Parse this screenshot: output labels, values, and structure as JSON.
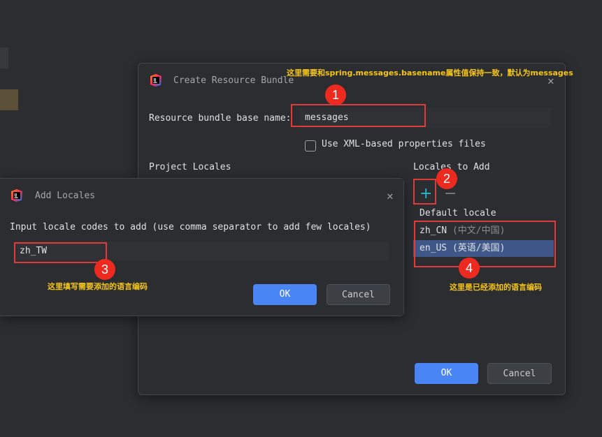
{
  "main_dialog": {
    "title": "Create Resource Bundle",
    "base_name_label": "Resource bundle base name:",
    "base_name_value": "messages",
    "xml_checkbox_label": "Use XML-based properties files",
    "project_locales_label": "Project Locales",
    "locales_to_add_label": "Locales to Add",
    "locales": [
      {
        "code": "Default locale",
        "hint": ""
      },
      {
        "code": "zh_CN",
        "hint": "(中文/中国)"
      },
      {
        "code": "en_US",
        "hint": "(英语/美国)"
      }
    ],
    "ok_label": "OK",
    "cancel_label": "Cancel",
    "add_symbol": "+",
    "remove_symbol": "−"
  },
  "add_dialog": {
    "title": "Add Locales",
    "prompt": "Input locale codes to add (use comma separator to add few locales)",
    "input_value": "zh_TW",
    "ok_label": "OK",
    "cancel_label": "Cancel"
  },
  "annotations": {
    "badge1": "1",
    "badge2": "2",
    "badge3": "3",
    "badge4": "4",
    "note_top": "这里需要和spring.messages.basename属性值保持一致，默认为messages",
    "note_input": "这里填写需要添加的语言编码",
    "note_list": "这里是已经添加的语言编码",
    "colors": {
      "badge": "#ec2a20",
      "box": "#e03b3b",
      "note": "#f5c518",
      "accent": "#4a85f5"
    }
  },
  "icons": {
    "logo": "intellij-logo-icon",
    "close": "close-icon",
    "checkbox": "checkbox-icon"
  }
}
